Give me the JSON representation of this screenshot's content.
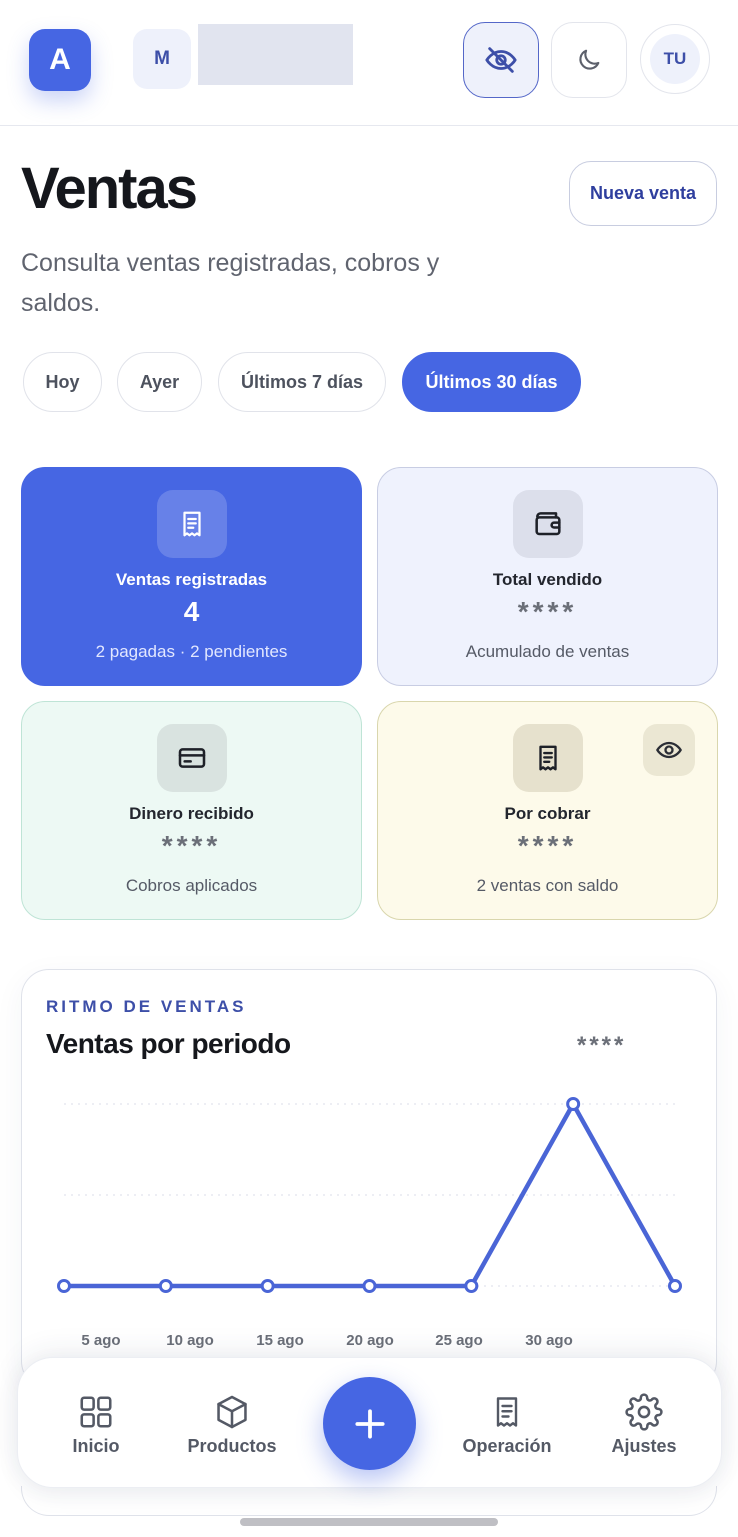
{
  "header": {
    "logo_letter": "A",
    "workspace_initial": "M",
    "user_initials": "TU"
  },
  "page": {
    "title": "Ventas",
    "subtitle": "Consulta ventas registradas, cobros y saldos.",
    "new_sale_label": "Nueva venta"
  },
  "filters": [
    {
      "label": "Hoy",
      "selected": false
    },
    {
      "label": "Ayer",
      "selected": false
    },
    {
      "label": "Últimos 7 días",
      "selected": false
    },
    {
      "label": "Últimos 30 días",
      "selected": true
    }
  ],
  "stats": [
    {
      "label": "Ventas registradas",
      "value": "4",
      "note": "2 pagadas · 2 pendientes",
      "icon": "receipt-icon"
    },
    {
      "label": "Total vendido",
      "value": "****",
      "note": "Acumulado de ventas",
      "icon": "wallet-icon"
    },
    {
      "label": "Dinero recibido",
      "value": "****",
      "note": "Cobros aplicados",
      "icon": "credit-card-icon"
    },
    {
      "label": "Por cobrar",
      "value": "****",
      "note": "2 ventas con saldo",
      "icon": "receipt-icon"
    }
  ],
  "chart": {
    "eyebrow": "RITMO DE VENTAS",
    "title": "Ventas por periodo",
    "total": "****"
  },
  "chart_data": {
    "type": "line",
    "x": [
      "5 ago",
      "10 ago",
      "15 ago",
      "20 ago",
      "25 ago",
      "30 ago",
      ""
    ],
    "tick_labels": [
      "5 ago",
      "10 ago",
      "15 ago",
      "20 ago",
      "25 ago",
      "30 ago"
    ],
    "series": [
      {
        "values": [
          0,
          0,
          0,
          0,
          0,
          1,
          0
        ]
      }
    ],
    "ylim": [
      0,
      1
    ],
    "grid": true,
    "color": "#4a65d6"
  },
  "nav": {
    "items": [
      {
        "label": "Inicio",
        "icon": "grid-icon"
      },
      {
        "label": "Productos",
        "icon": "box-icon"
      },
      {
        "label": "Operación",
        "icon": "receipt-icon"
      },
      {
        "label": "Ajustes",
        "icon": "gear-icon"
      }
    ],
    "fab_icon": "plus-icon"
  },
  "colors": {
    "accent": "#4666e3",
    "accent_dark": "#3d4fa8"
  }
}
